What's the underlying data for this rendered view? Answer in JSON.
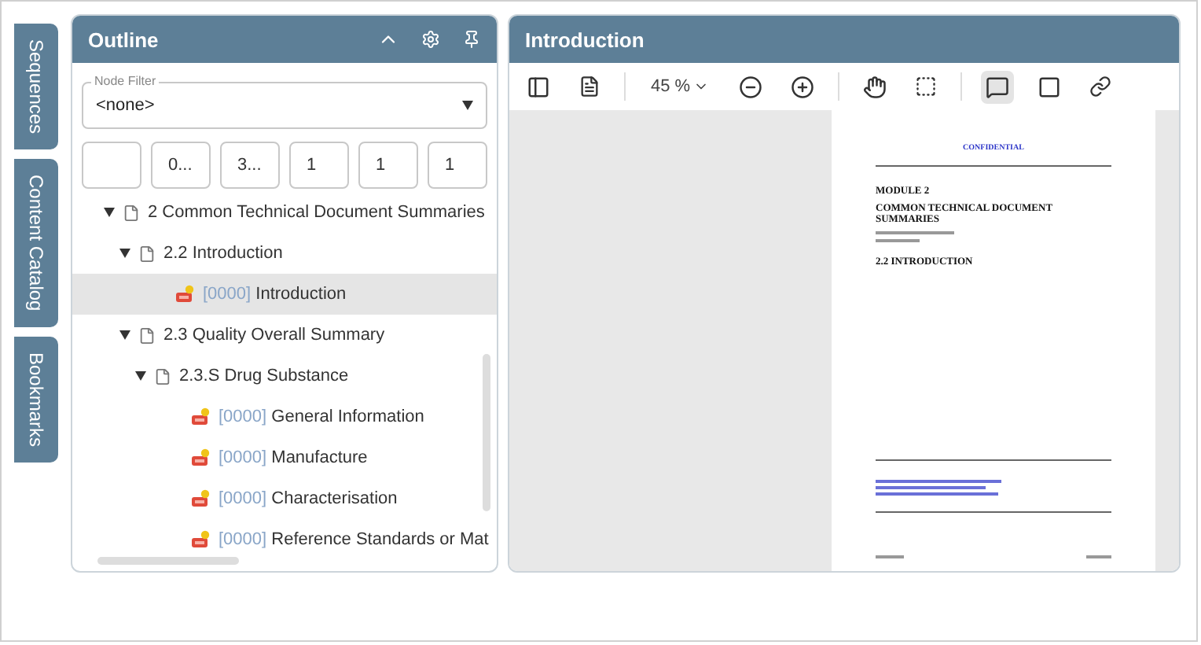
{
  "side_tabs": [
    {
      "label": "Sequences"
    },
    {
      "label": "Content Catalog"
    },
    {
      "label": "Bookmarks"
    }
  ],
  "outline": {
    "title": "Outline",
    "node_filter": {
      "label": "Node Filter",
      "value": "<none>"
    },
    "filter_boxes": [
      {
        "kind": "empty"
      },
      {
        "kind": "text",
        "value": "0..."
      },
      {
        "kind": "text",
        "value": "3..."
      },
      {
        "kind": "text",
        "value": "1"
      },
      {
        "kind": "text",
        "value": "1"
      },
      {
        "kind": "text",
        "value": "1"
      }
    ],
    "tree": [
      {
        "kind": "folder",
        "label": "2 Common Technical Document Summaries",
        "expanded": true,
        "children": [
          {
            "kind": "folder",
            "label": "2.2 Introduction",
            "expanded": true,
            "children": [
              {
                "kind": "document",
                "code": "[0000]",
                "label": "Introduction",
                "selected": true
              }
            ]
          },
          {
            "kind": "folder",
            "label": "2.3 Quality Overall Summary",
            "expanded": true,
            "children": [
              {
                "kind": "folder",
                "label": "2.3.S Drug Substance",
                "expanded": true,
                "children": [
                  {
                    "kind": "document",
                    "code": "[0000]",
                    "label": "General Information",
                    "selected": false
                  },
                  {
                    "kind": "document",
                    "code": "[0000]",
                    "label": "Manufacture",
                    "selected": false
                  },
                  {
                    "kind": "document",
                    "code": "[0000]",
                    "label": "Characterisation",
                    "selected": false
                  },
                  {
                    "kind": "document",
                    "code": "[0000]",
                    "label": "Reference Standards or Mat",
                    "selected": false
                  }
                ]
              }
            ]
          }
        ]
      }
    ]
  },
  "viewer": {
    "title": "Introduction",
    "zoom": "45 %",
    "comment_tool_selected": true,
    "page": {
      "header": "CONFIDENTIAL",
      "module": "MODULE 2",
      "heading": "COMMON TECHNICAL DOCUMENT SUMMARIES",
      "section": "2.2 INTRODUCTION"
    }
  }
}
